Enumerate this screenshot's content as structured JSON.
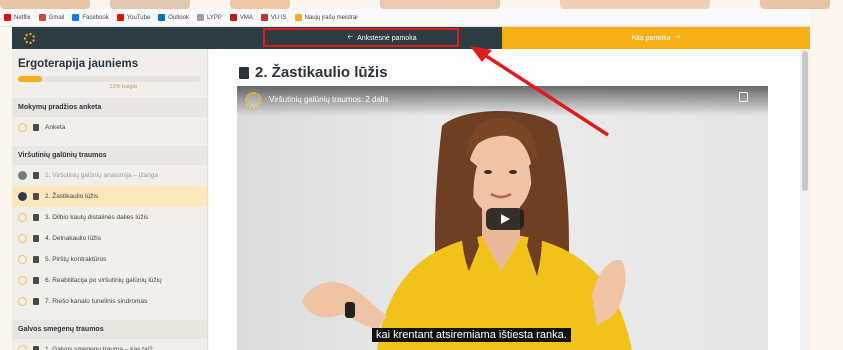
{
  "bookmarks": [
    {
      "label": "Netflix",
      "color": "#e50914"
    },
    {
      "label": "Gmail",
      "color": "#d44638"
    },
    {
      "label": "Facebook",
      "color": "#1877f2"
    },
    {
      "label": "YouTube",
      "color": "#ff0000"
    },
    {
      "label": "Outlook",
      "color": "#0072c6"
    },
    {
      "label": "LYPP",
      "color": "#9aa0a6"
    },
    {
      "label": "VMA",
      "color": "#b41e1e"
    },
    {
      "label": "VU IS",
      "color": "#c9302c"
    },
    {
      "label": "Naujų įrašų meistrai",
      "color": "#f5b015"
    }
  ],
  "nav": {
    "prev_label": "Ankstesnė pamoka",
    "next_label": "Kita pamoka",
    "accent": "#f5b015",
    "dark": "#2e3d44"
  },
  "sidebar": {
    "course_title": "Ergoterapija jauniems",
    "progress": 0.13,
    "progress_text": "13% baigta",
    "sections": [
      {
        "title": "Mokymų pradžios anketa",
        "items": [
          {
            "label": "Anketa",
            "state": "todo"
          }
        ]
      },
      {
        "title": "Viršutinių galūnių traumos",
        "items": [
          {
            "label": "1. Viršutinių galūnių anatomija – įžanga",
            "state": "done"
          },
          {
            "label": "2. Žastikaulio lūžis",
            "state": "current"
          },
          {
            "label": "3. Dilbio kaulų distalinės dalies lūžis",
            "state": "todo"
          },
          {
            "label": "4. Delnakaulio lūžis",
            "state": "todo"
          },
          {
            "label": "5. Pirštų kontraktūros",
            "state": "todo"
          },
          {
            "label": "6. Reabilitacija po viršutinių galūnių lūžių",
            "state": "todo"
          },
          {
            "label": "7. Riešo kanalo tunelinis sindromas",
            "state": "todo"
          }
        ]
      },
      {
        "title": "Galvos smegenų traumos",
        "items": [
          {
            "label": "1. Galvos smegenų trauma – kas tai?",
            "state": "todo"
          }
        ]
      }
    ]
  },
  "lesson": {
    "title": "2. Žastikaulio lūžis"
  },
  "video": {
    "title": "Viršutinių galūnių traumos: 2 dalis",
    "caption": "kai krentant atsiremiama ištiesta ranka."
  }
}
